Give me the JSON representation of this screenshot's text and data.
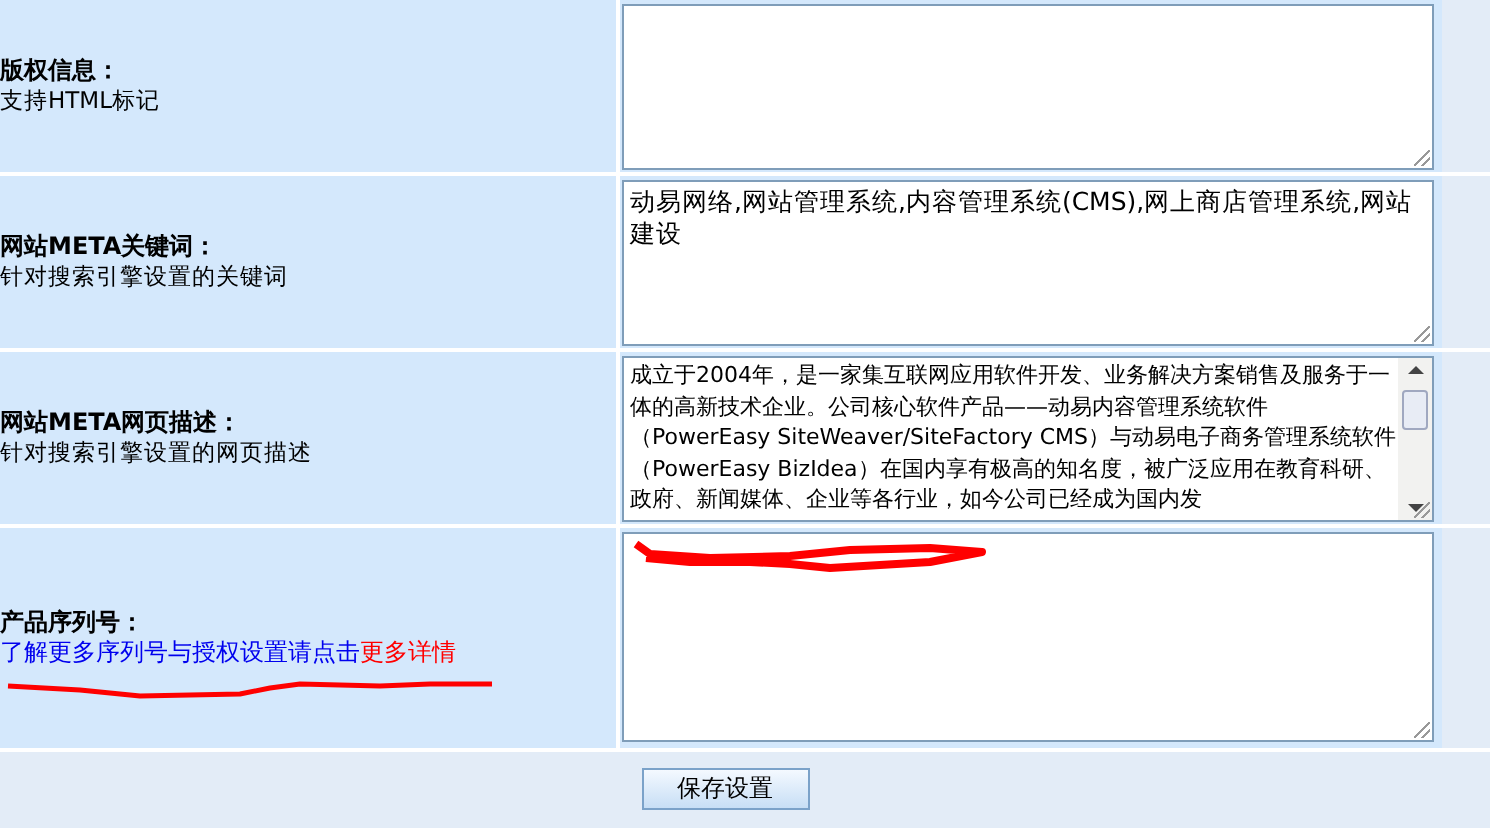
{
  "rows": [
    {
      "kind": "text",
      "title": "版权信息：",
      "note": "支持HTML标记"
    },
    {
      "kind": "text",
      "title": "网站META关键词：",
      "note": "针对搜索引擎设置的关键词",
      "value": "动易网络,网站管理系统,内容管理系统(CMS),网上商店管理系统,网站建设"
    },
    {
      "kind": "scroll",
      "title": "网站META网页描述：",
      "note": "针对搜索引擎设置的网页描述",
      "value": "成立于2004年，是一家集互联网应用软件开发、业务解决方案销售及服务于一体的高新技术企业。公司核心软件产品——动易内容管理系统软件（PowerEasy SiteWeaver/SiteFactory CMS）与动易电子商务管理系统软件（PowerEasy BizIdea）在国内享有极高的知名度，被广泛应用在教育科研、政府、新闻媒体、企业等各行业，如今公司已经成为国内发"
    },
    {
      "kind": "serial",
      "title": "产品序列号：",
      "hint": "了解更多序列号与授权设置请点击",
      "link": "更多详情",
      "redacted": true,
      "underlined": true
    }
  ],
  "save_button": "保存设置"
}
